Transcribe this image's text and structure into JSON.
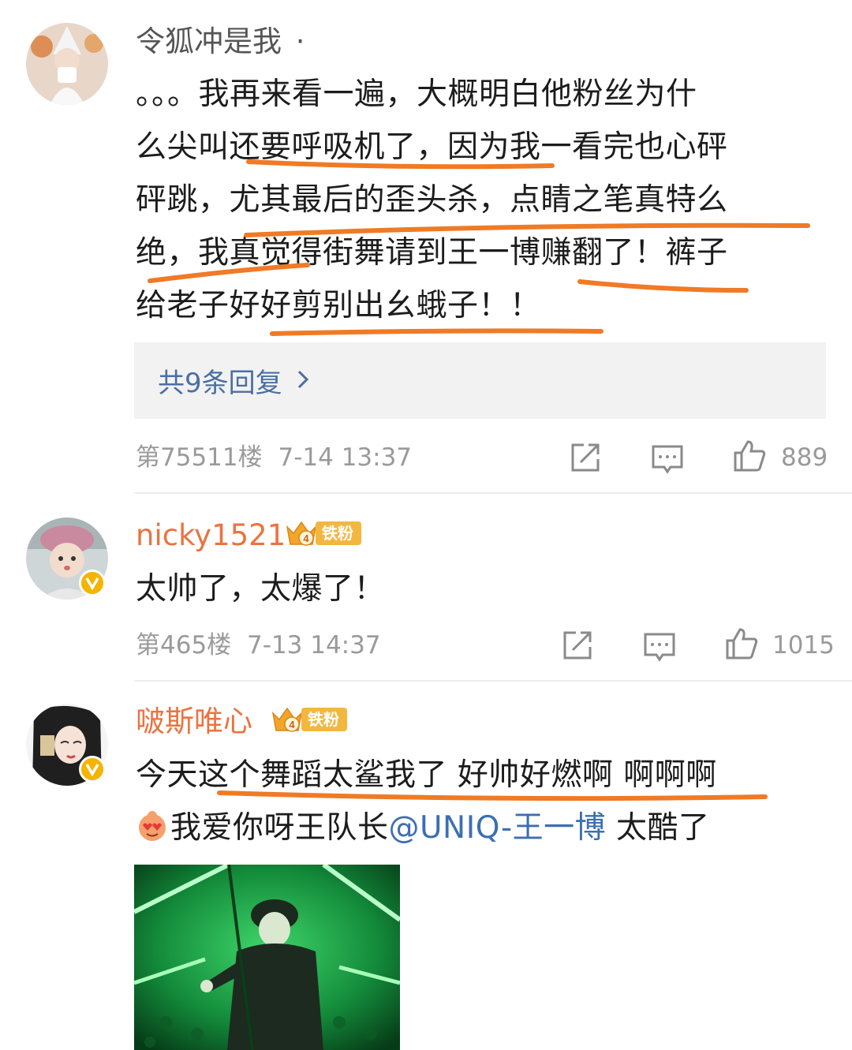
{
  "comments": [
    {
      "username": "令狐冲是我",
      "username_suffix": "·",
      "text_lines": [
        "。。。我再来看一遍，大概明白他粉丝为什",
        "么尖叫还要呼吸机了，因为我一看完也心砰",
        "砰跳，尤其最后的歪头杀，点睛之笔真特么",
        "绝，我真觉得街舞请到王一博赚翻了！裤子",
        "给老子好好剪别出幺蛾子！！"
      ],
      "replies_label": "共9条回复",
      "floor": "第75511楼",
      "time": "7-14 13:37",
      "likes": "889"
    },
    {
      "username": "nicky1521",
      "fan_badge": "铁粉",
      "fan_level": "4",
      "text_lines": [
        "太帅了，太爆了！"
      ],
      "floor": "第465楼",
      "time": "7-13 14:37",
      "likes": "1015"
    },
    {
      "username": "啵斯唯心",
      "fan_badge": "铁粉",
      "fan_level": "4",
      "text_line1": "今天这个舞蹈太鲨我了 好帅好燃啊  啊啊啊",
      "text_line2_pre": "我爱你呀王队长",
      "mention": "@UNIQ-王一博",
      "text_line2_post": " 太酷了"
    }
  ],
  "icons": {
    "share": "share-icon",
    "comment": "comment-icon",
    "like": "thumbs-up-icon",
    "chevron": "chevron-right-icon",
    "verified": "verified-icon",
    "emoji": "heart-eyes-emoji-icon"
  },
  "colors": {
    "username_orange": "#eb7340",
    "mention_blue": "#3c6fb2",
    "highlight_underline": "#f07a25",
    "badge_gold": "#f3b740"
  }
}
